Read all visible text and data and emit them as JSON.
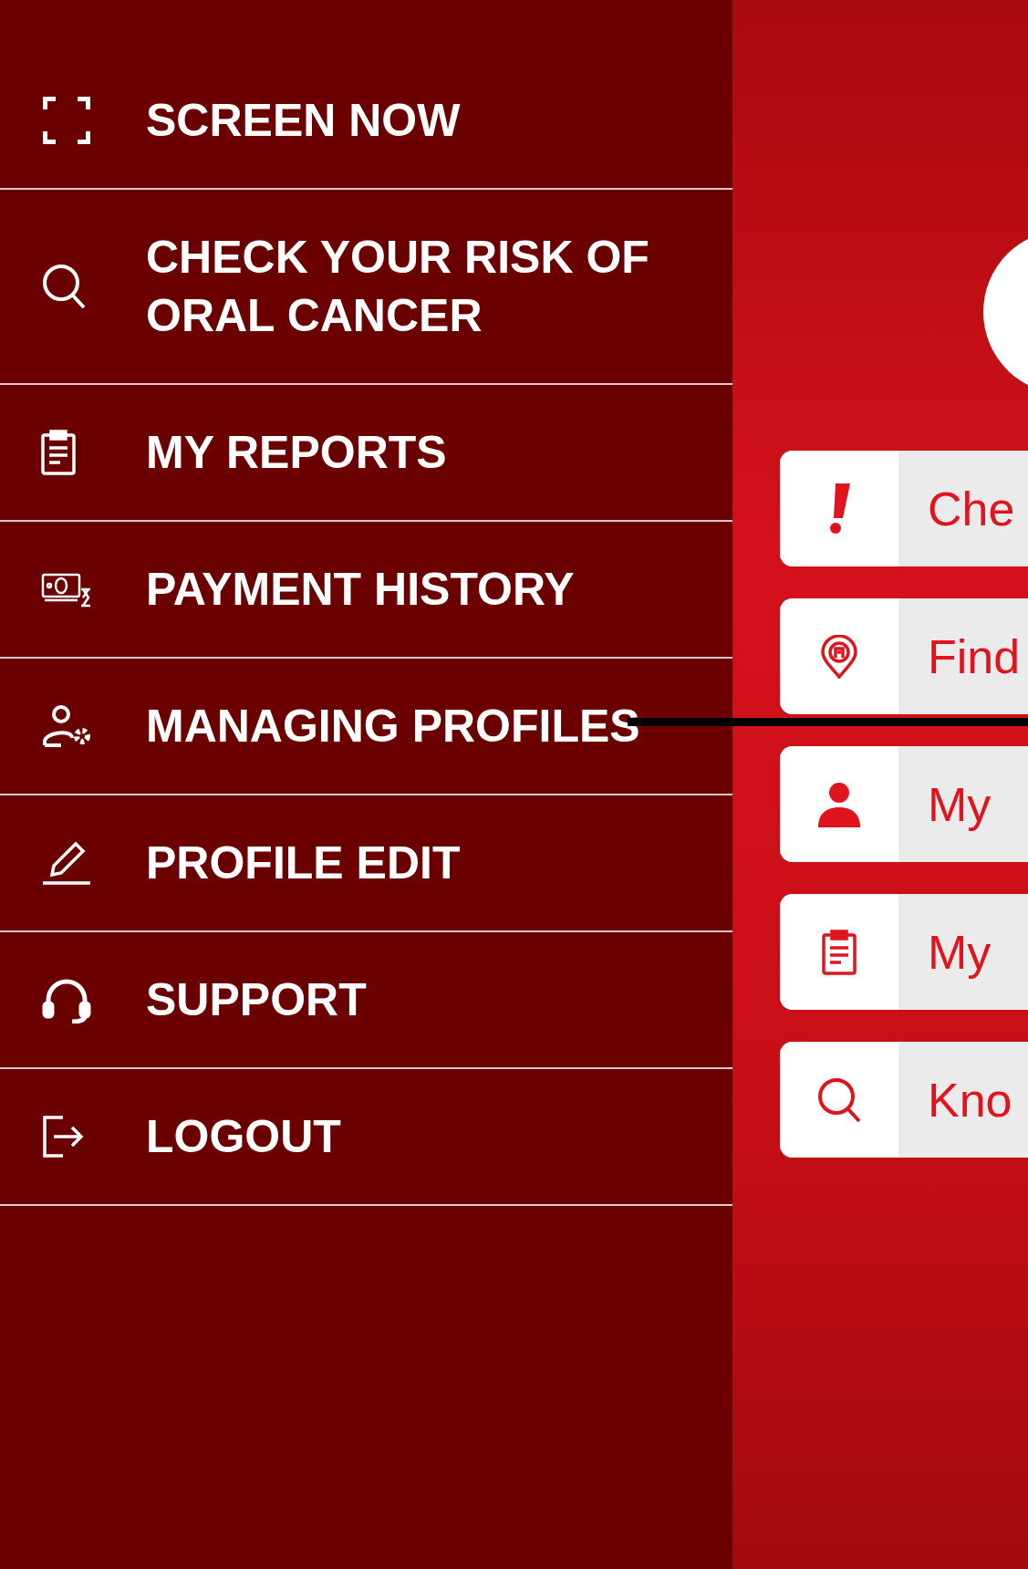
{
  "drawer": {
    "items": [
      {
        "kind": "scan",
        "label": "SCREEN NOW"
      },
      {
        "kind": "search",
        "label": "CHECK YOUR RISK OF ORAL CANCER"
      },
      {
        "kind": "clipboard",
        "label": "MY REPORTS"
      },
      {
        "kind": "payment",
        "label": "PAYMENT HISTORY"
      },
      {
        "kind": "profiles",
        "label": "MANAGING PROFILES"
      },
      {
        "kind": "pencil",
        "label": "PROFILE EDIT"
      },
      {
        "kind": "headset",
        "label": "SUPPORT"
      },
      {
        "kind": "logout",
        "label": "LOGOUT"
      }
    ]
  },
  "home": {
    "cards": [
      {
        "kind": "alert",
        "label": "Che"
      },
      {
        "kind": "pin",
        "label": "Find"
      },
      {
        "kind": "person",
        "label": "My"
      },
      {
        "kind": "clipboard",
        "label": "My"
      },
      {
        "kind": "search",
        "label": "Kno"
      }
    ]
  }
}
